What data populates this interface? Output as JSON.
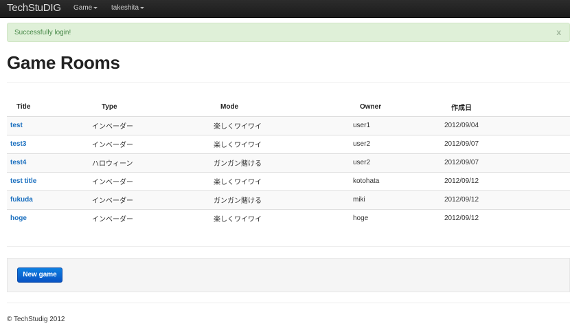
{
  "navbar": {
    "brand": "TechStuDIG",
    "menus": [
      "Game",
      "takeshita"
    ]
  },
  "alert": {
    "message": "Successfully login!",
    "close": "x"
  },
  "page_title": "Game Rooms",
  "table": {
    "headers": [
      "Title",
      "Type",
      "Mode",
      "Owner",
      "作成日"
    ],
    "rows": [
      {
        "title": "test",
        "type": "インベーダー",
        "mode": "楽しくワイワイ",
        "owner": "user1",
        "date": "2012/09/04"
      },
      {
        "title": "test3",
        "type": "インベーダー",
        "mode": "楽しくワイワイ",
        "owner": "user2",
        "date": "2012/09/07"
      },
      {
        "title": "test4",
        "type": "ハロウィーン",
        "mode": "ガンガン賭ける",
        "owner": "user2",
        "date": "2012/09/07"
      },
      {
        "title": "test title",
        "type": "インベーダー",
        "mode": "楽しくワイワイ",
        "owner": "kotohata",
        "date": "2012/09/12"
      },
      {
        "title": "fukuda",
        "type": "インベーダー",
        "mode": "ガンガン賭ける",
        "owner": "miki",
        "date": "2012/09/12"
      },
      {
        "title": "hoge",
        "type": "インベーダー",
        "mode": "楽しくワイワイ",
        "owner": "hoge",
        "date": "2012/09/12"
      }
    ]
  },
  "actions": {
    "new_game": "New game"
  },
  "footer": "© TechStudig 2012",
  "colors": {
    "link": "#1a6fbf",
    "alert_bg": "#dff0d8",
    "primary": "#0a6fd8"
  }
}
